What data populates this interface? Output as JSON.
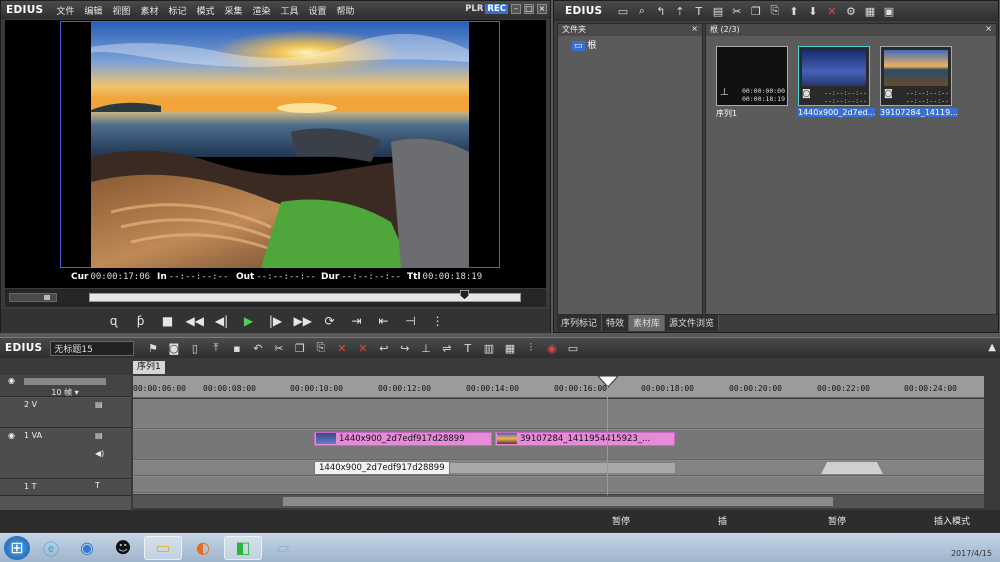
{
  "player": {
    "logo": "EDIUS",
    "menu": [
      "文件",
      "编辑",
      "视图",
      "素材",
      "标记",
      "模式",
      "采集",
      "渲染",
      "工具",
      "设置",
      "帮助"
    ],
    "plr_label": "PLR",
    "rec_label": "REC",
    "timecodes": {
      "cur_label": "Cur",
      "cur": "00:00:17:06",
      "in_label": "In",
      "in": "--:--:--:--",
      "out_label": "Out",
      "out": "--:--:--:--",
      "dur_label": "Dur",
      "dur": "--:--:--:--",
      "ttl_label": "Ttl",
      "ttl": "00:00:18:19"
    },
    "playhead_position": 0.87
  },
  "bin": {
    "logo": "EDIUS",
    "folder_header": "文件夹",
    "root_folder": "根",
    "bin_header": "根 (2/3)",
    "items": [
      {
        "name": "序列1",
        "tc1": "00:00:00:00",
        "tc2": "00:00:18:19"
      },
      {
        "name": "1440x900_2d7ed...",
        "tc1": "--:--:--:--",
        "tc2": "--:--:--:--"
      },
      {
        "name": "39107284_14119...",
        "tc1": "--:--:--:--",
        "tc2": "--:--:--:--"
      }
    ],
    "tabs": [
      "序列标记",
      "特效",
      "素材库",
      "源文件浏览"
    ],
    "active_tab": "素材库"
  },
  "timeline": {
    "logo": "EDIUS",
    "project": "无标题15",
    "sequence_tab": "序列1",
    "zoom": "10 帧",
    "ruler_ticks": [
      "00:00:06:00",
      "00:00:08:00",
      "00:00:10:00",
      "00:00:12:00",
      "00:00:14:00",
      "00:00:16:00",
      "00:00:18:00",
      "00:00:20:00",
      "00:00:22:00",
      "00:00:24:00"
    ],
    "tracks": [
      "2 V",
      "1 VA",
      "1 T"
    ],
    "clips": [
      {
        "name": "1440x900_2d7edf917d28899"
      },
      {
        "name": "39107284_1411954415923_..."
      }
    ],
    "tooltip": "1440x900_2d7edf917d28899",
    "status": [
      "暂停",
      "插",
      "暂停",
      "插入模式"
    ]
  },
  "taskbar": {
    "icons": [
      "start-orb-icon",
      "ie-icon",
      "media-player-icon",
      "qq-icon",
      "explorer-icon",
      "firefox-icon",
      "edius-icon",
      "notepad-icon"
    ],
    "clock": "2017/4/15"
  },
  "colors": {
    "accent_blue": "#3a6fd4",
    "clip_pink": "#e58bd8",
    "cursor_teal": "#41c7a0"
  }
}
